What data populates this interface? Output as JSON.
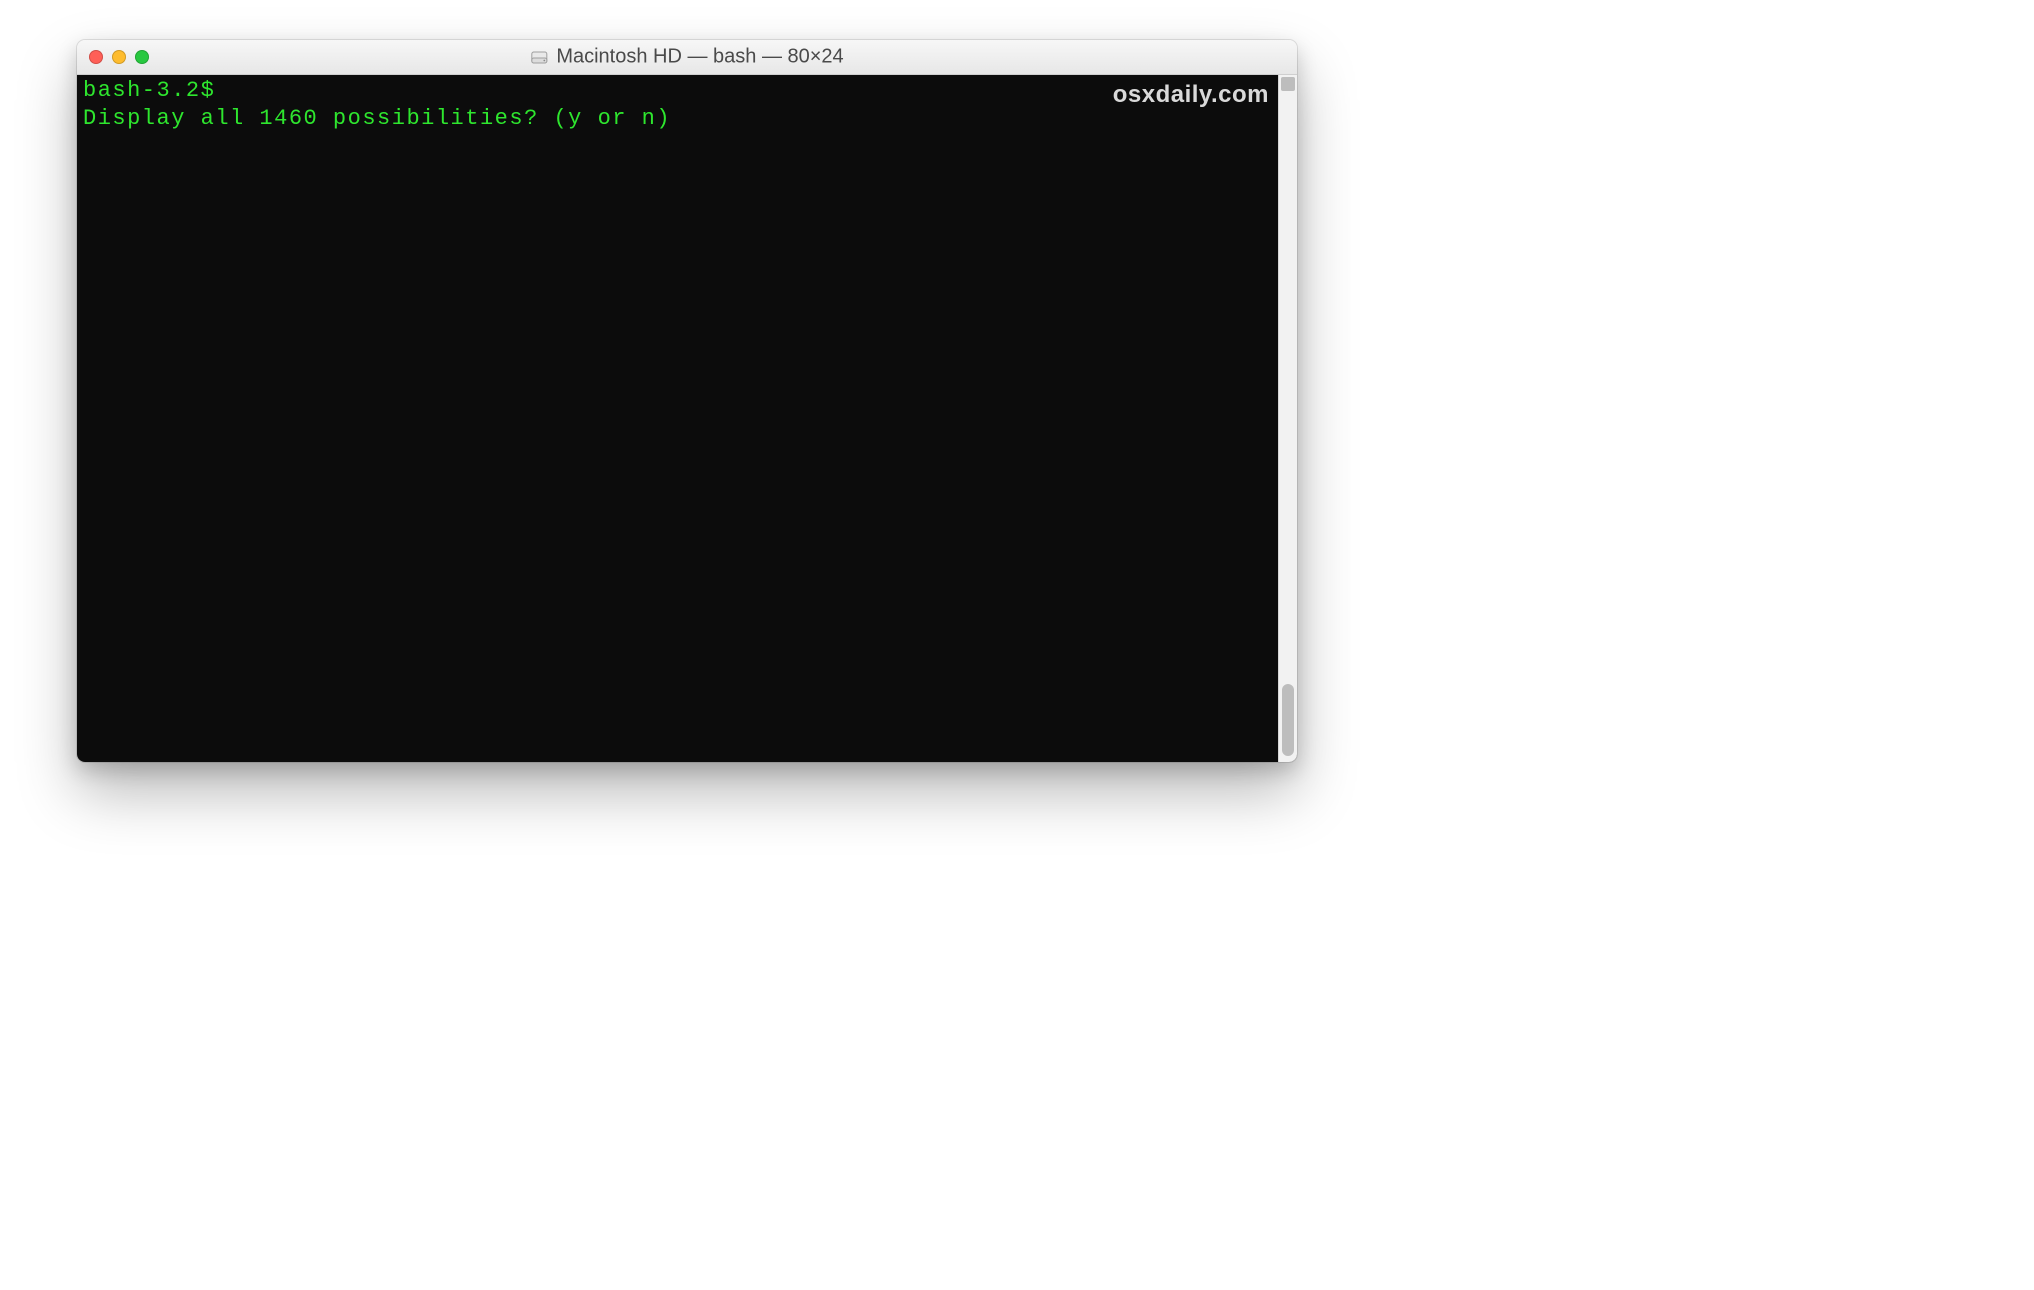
{
  "window": {
    "title": "Macintosh HD — bash — 80×24"
  },
  "terminal": {
    "prompt": "bash-3.2$",
    "message": "Display all 1460 possibilities? (y or n)",
    "fg_color": "#2ee62e",
    "bg_color": "#0c0c0c",
    "font_family": "Menlo",
    "columns": 80,
    "rows": 24
  },
  "watermark": "osxdaily.com",
  "traffic_lights": {
    "close": "#ff5f57",
    "minimize": "#febc2e",
    "zoom": "#28c840"
  }
}
